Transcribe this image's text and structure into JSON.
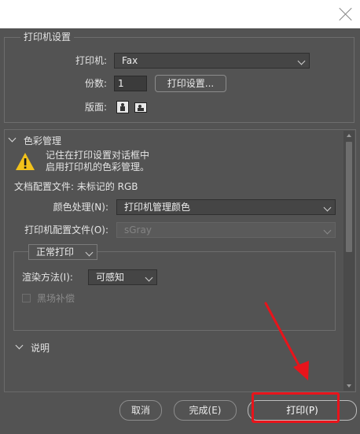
{
  "printer_settings": {
    "legend": "打印机设置",
    "printer_label": "打印机:",
    "printer_value": "Fax",
    "copies_label": "份数:",
    "copies_value": "1",
    "print_settings_button": "打印设置...",
    "layout_label": "版面:"
  },
  "color_management": {
    "title": "色彩管理",
    "warning_line1": "记住在打印设置对话框中",
    "warning_line2": "启用打印机的色彩管理。",
    "doc_profile": "文档配置文件: 未标记的 RGB",
    "color_handling_label": "颜色处理(N):",
    "color_handling_value": "打印机管理颜色",
    "printer_profile_label": "打印机配置文件(O):",
    "printer_profile_value": "sGray",
    "mode_value": "正常打印",
    "rendering_intent_label": "渲染方法(I):",
    "rendering_intent_value": "可感知",
    "black_point_label": "黑场补偿"
  },
  "description": {
    "title": "说明"
  },
  "footer": {
    "cancel": "取消",
    "done": "完成(E)",
    "print": "打印(P)"
  },
  "colors": {
    "dialog_bg": "#535353",
    "annotation_red": "#e8141b",
    "warning_yellow": "#f2c21b"
  }
}
